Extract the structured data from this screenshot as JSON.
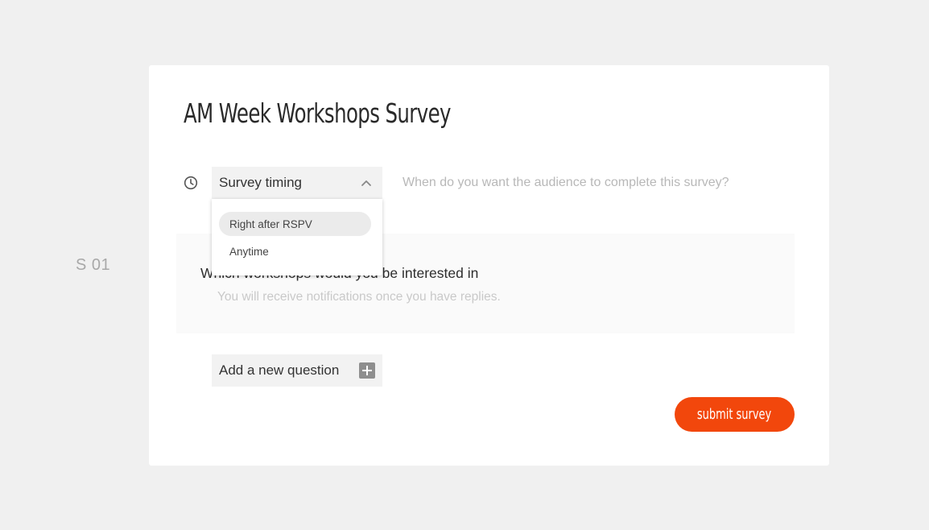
{
  "side_label": "S 01",
  "survey": {
    "title": "AM Week Workshops Survey",
    "timing_select": {
      "label": "Survey timing",
      "options": [
        "Right after RSPV",
        "Anytime"
      ],
      "selected": "Right after RSPV"
    },
    "timing_hint": "When do you want the audience to complete this survey?",
    "question": {
      "text": "Which workshops would you be interested in",
      "subtext": "You will receive notifications once you have replies."
    },
    "add_question_label": "Add a new question",
    "submit_label": "submit survey"
  },
  "colors": {
    "background": "#f0f0f0",
    "card": "#ffffff",
    "accent": "#f2470c",
    "field": "#f2f2f2"
  },
  "icons": {
    "timing": "clock-icon",
    "dropdown": "chevron-up-icon",
    "add": "plus-icon"
  }
}
